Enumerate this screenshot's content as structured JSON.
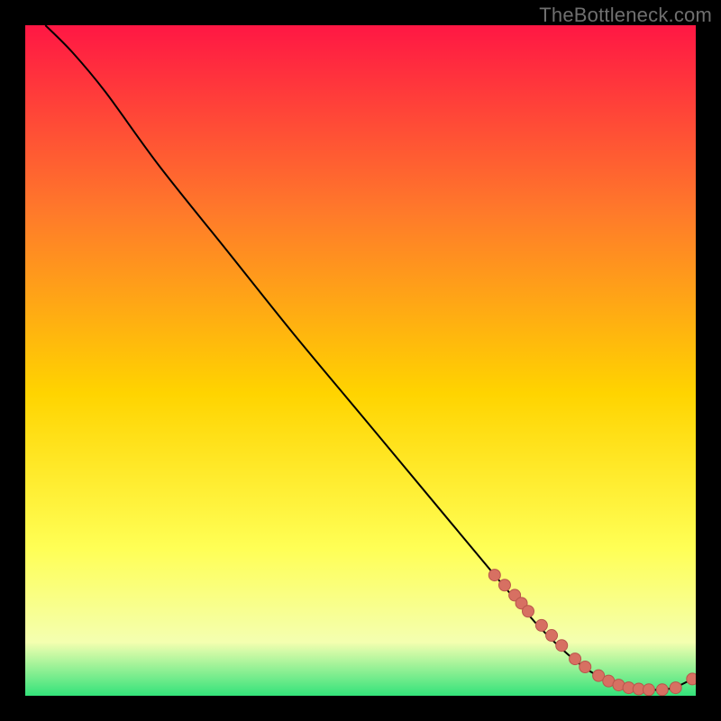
{
  "watermark": "TheBottleneck.com",
  "colors": {
    "background": "#000000",
    "curve": "#000000",
    "marker_fill": "#d77062",
    "marker_stroke": "#b9564c",
    "gradient_top": "#ff1744",
    "gradient_mid1": "#ff7a2a",
    "gradient_mid2": "#ffd400",
    "gradient_mid3": "#ffff55",
    "gradient_mid4": "#f4ffb0",
    "gradient_bottom": "#33e27a"
  },
  "chart_data": {
    "type": "line",
    "title": "",
    "xlabel": "",
    "ylabel": "",
    "xlim": [
      0,
      100
    ],
    "ylim": [
      0,
      100
    ],
    "grid": false,
    "legend": false,
    "series": [
      {
        "name": "curve",
        "x": [
          3,
          7,
          12,
          20,
          30,
          40,
          50,
          60,
          70,
          76,
          80,
          83,
          85,
          87,
          89,
          91,
          93,
          95,
          97,
          99.5
        ],
        "y": [
          100,
          96,
          90,
          79,
          66.5,
          54,
          42,
          30,
          18,
          11,
          7,
          4.5,
          3.2,
          2.2,
          1.5,
          1.1,
          0.9,
          0.9,
          1.3,
          2.5
        ]
      }
    ],
    "markers": {
      "name": "highlighted-points",
      "x": [
        70,
        71.5,
        73,
        74,
        75,
        77,
        78.5,
        80,
        82,
        83.5,
        85.5,
        87,
        88.5,
        90,
        91.5,
        93,
        95,
        97,
        99.5
      ],
      "y": [
        18,
        16.5,
        15,
        13.8,
        12.6,
        10.5,
        9,
        7.5,
        5.5,
        4.3,
        3.0,
        2.2,
        1.6,
        1.2,
        1.0,
        0.9,
        0.9,
        1.2,
        2.5
      ]
    }
  }
}
